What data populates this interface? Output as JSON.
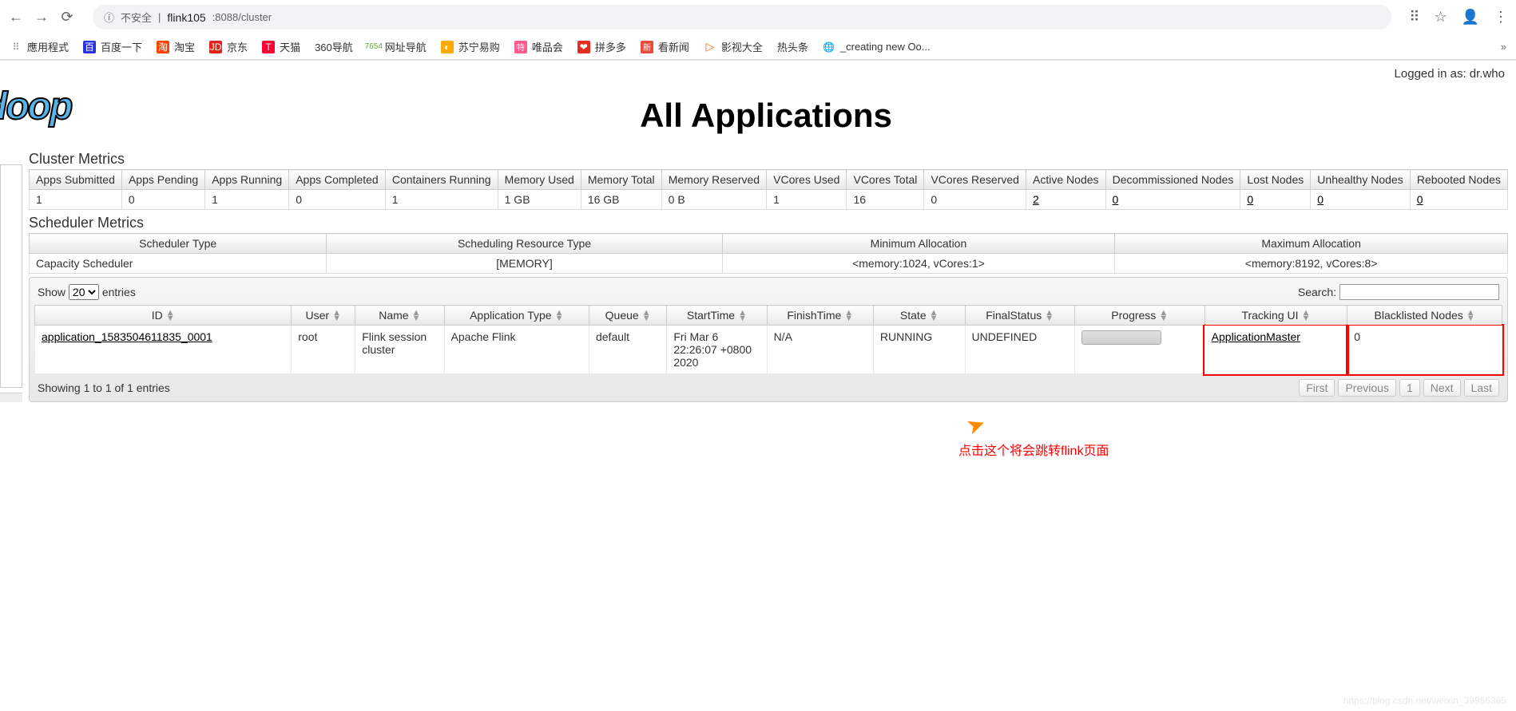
{
  "browser": {
    "insecure_label": "不安全",
    "url_host": "flink105",
    "url_port_path": ":8088/cluster"
  },
  "bookmarks": {
    "apps": "應用程式",
    "baidu": "百度一下",
    "taobao": "淘宝",
    "jd": "京东",
    "tmall": "天猫",
    "nav360": "360导航",
    "wzdh": "网址导航",
    "suning": "苏宁易购",
    "vip": "唯品会",
    "pdd": "拼多多",
    "kxw": "看新闻",
    "ysdq": "影视大全",
    "rtt": "热头条",
    "creating": "_creating new Oo...",
    "more": "»"
  },
  "header": {
    "logged_in_prefix": "Logged in as: ",
    "user": "dr.who",
    "logo": "doop",
    "title": "All Applications"
  },
  "cluster_metrics": {
    "title": "Cluster Metrics",
    "headers": [
      "Apps Submitted",
      "Apps Pending",
      "Apps Running",
      "Apps Completed",
      "Containers Running",
      "Memory Used",
      "Memory Total",
      "Memory Reserved",
      "VCores Used",
      "VCores Total",
      "VCores Reserved",
      "Active Nodes",
      "Decommissioned Nodes",
      "Lost Nodes",
      "Unhealthy Nodes",
      "Rebooted Nodes"
    ],
    "values": [
      "1",
      "0",
      "1",
      "0",
      "1",
      "1 GB",
      "16 GB",
      "0 B",
      "1",
      "16",
      "0",
      "2",
      "0",
      "0",
      "0",
      "0"
    ]
  },
  "scheduler_metrics": {
    "title": "Scheduler Metrics",
    "headers": [
      "Scheduler Type",
      "Scheduling Resource Type",
      "Minimum Allocation",
      "Maximum Allocation"
    ],
    "values": [
      "Capacity Scheduler",
      "[MEMORY]",
      "<memory:1024, vCores:1>",
      "<memory:8192, vCores:8>"
    ]
  },
  "datatable": {
    "show_label": "Show",
    "entries_label": "entries",
    "show_value": "20",
    "search_label": "Search:",
    "headers": [
      "ID",
      "User",
      "Name",
      "Application Type",
      "Queue",
      "StartTime",
      "FinishTime",
      "State",
      "FinalStatus",
      "Progress",
      "Tracking UI",
      "Blacklisted Nodes"
    ],
    "row": {
      "id": "application_1583504611835_0001",
      "user": "root",
      "name": "Flink session cluster",
      "app_type": "Apache Flink",
      "queue": "default",
      "start_time": "Fri Mar 6 22:26:07 +0800 2020",
      "finish_time": "N/A",
      "state": "RUNNING",
      "final_status": "UNDEFINED",
      "tracking_ui": "ApplicationMaster",
      "blacklisted": "0"
    },
    "info": "Showing 1 to 1 of 1 entries",
    "pagination": [
      "First",
      "Previous",
      "1",
      "Next",
      "Last"
    ]
  },
  "annotation": "点击这个将会跳转flink页面",
  "watermark": "https://blog.csdn.net/weixin_39966385"
}
